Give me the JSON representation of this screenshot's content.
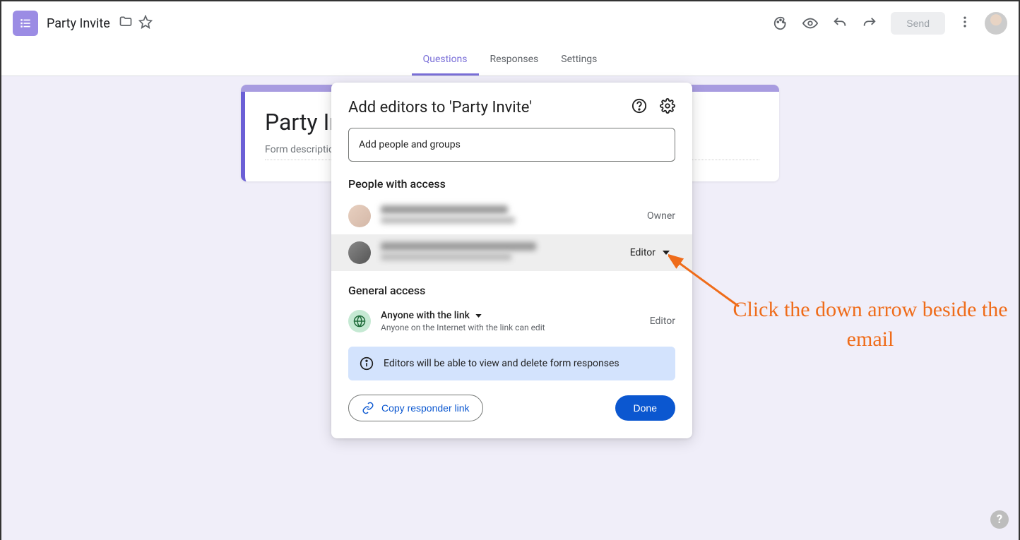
{
  "header": {
    "doc_title": "Party Invite",
    "send_label": "Send"
  },
  "tabs": {
    "questions": "Questions",
    "responses": "Responses",
    "settings": "Settings"
  },
  "form": {
    "title": "Party Invite",
    "description_placeholder": "Form description"
  },
  "dialog": {
    "title": "Add editors to 'Party Invite'",
    "add_placeholder": "Add people and groups",
    "people_section": "People with access",
    "owner_label": "Owner",
    "editor_label": "Editor",
    "general_section": "General access",
    "general_title": "Anyone with the link",
    "general_sub": "Anyone on the Internet with the link can edit",
    "general_role": "Editor",
    "notice": "Editors will be able to view and delete form responses",
    "copy_link": "Copy responder link",
    "done": "Done"
  },
  "annotation": {
    "text": "Click the down arrow beside the email"
  }
}
